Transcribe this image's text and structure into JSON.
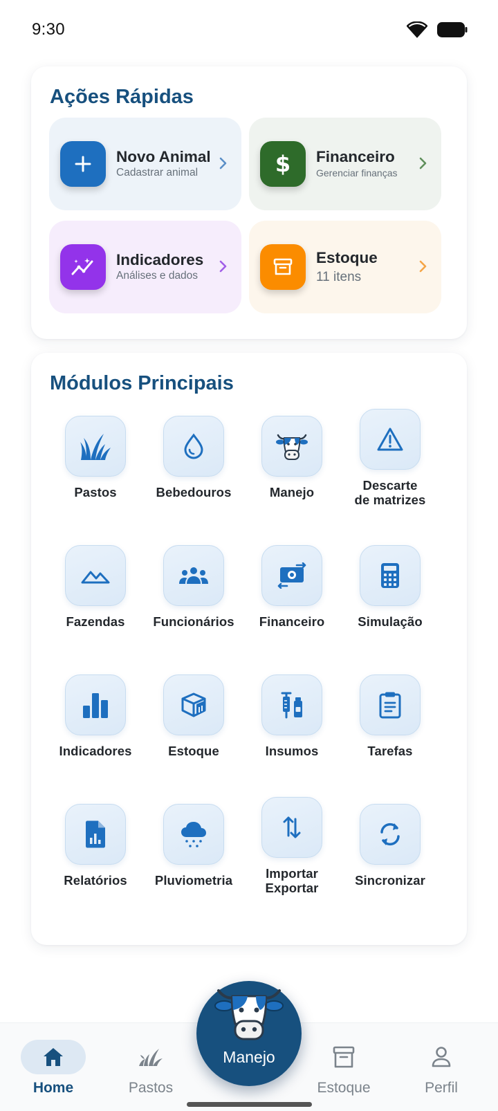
{
  "status": {
    "time": "9:30"
  },
  "quick_actions": {
    "title": "Ações Rápidas",
    "items": [
      {
        "title": "Novo Animal",
        "subtitle": "Cadastrar animal",
        "icon": "plus-icon",
        "accent": "#1e6fbf",
        "bg": "#edf3f9"
      },
      {
        "title": "Financeiro",
        "subtitle": "Gerenciar finanças",
        "icon": "dollar-icon",
        "accent": "#2e6b2a",
        "bg": "#eff3ef"
      },
      {
        "title": "Indicadores",
        "subtitle": "Análises e dados",
        "icon": "analytics-icon",
        "accent": "#9333ea",
        "bg": "#f6edfc"
      },
      {
        "title": "Estoque",
        "subtitle": "11 itens",
        "icon": "archive-icon",
        "accent": "#fb8c00",
        "bg": "#fdf6ec"
      }
    ]
  },
  "modules": {
    "title": "Módulos Principais",
    "items": [
      {
        "label": "Pastos",
        "icon": "grass-icon"
      },
      {
        "label": "Bebedouros",
        "icon": "water-drop-icon"
      },
      {
        "label": "Manejo",
        "icon": "cow-icon"
      },
      {
        "label": "Descarte\nde matrizes",
        "icon": "warning-icon"
      },
      {
        "label": "Fazendas",
        "icon": "landscape-icon"
      },
      {
        "label": "Funcionários",
        "icon": "group-icon"
      },
      {
        "label": "Financeiro",
        "icon": "money-exchange-icon"
      },
      {
        "label": "Simulação",
        "icon": "calculator-icon"
      },
      {
        "label": "Indicadores",
        "icon": "bar-chart-icon"
      },
      {
        "label": "Estoque",
        "icon": "box-icon"
      },
      {
        "label": "Insumos",
        "icon": "vaccine-icon"
      },
      {
        "label": "Tarefas",
        "icon": "clipboard-icon"
      },
      {
        "label": "Relatórios",
        "icon": "report-icon"
      },
      {
        "label": "Pluviometria",
        "icon": "rain-icon"
      },
      {
        "label": "Importar\nExportar",
        "icon": "import-export-icon"
      },
      {
        "label": "Sincronizar",
        "icon": "sync-icon"
      }
    ]
  },
  "bottom_nav": {
    "items": [
      {
        "label": "Home",
        "icon": "home-icon",
        "active": true
      },
      {
        "label": "Pastos",
        "icon": "grass-icon",
        "active": false
      },
      {
        "label": "Estoque",
        "icon": "archive-icon",
        "active": false
      },
      {
        "label": "Perfil",
        "icon": "person-icon",
        "active": false
      }
    ],
    "fab_label": "Manejo"
  },
  "colors": {
    "primary": "#17507e",
    "module_icon": "#1e6fbf"
  }
}
